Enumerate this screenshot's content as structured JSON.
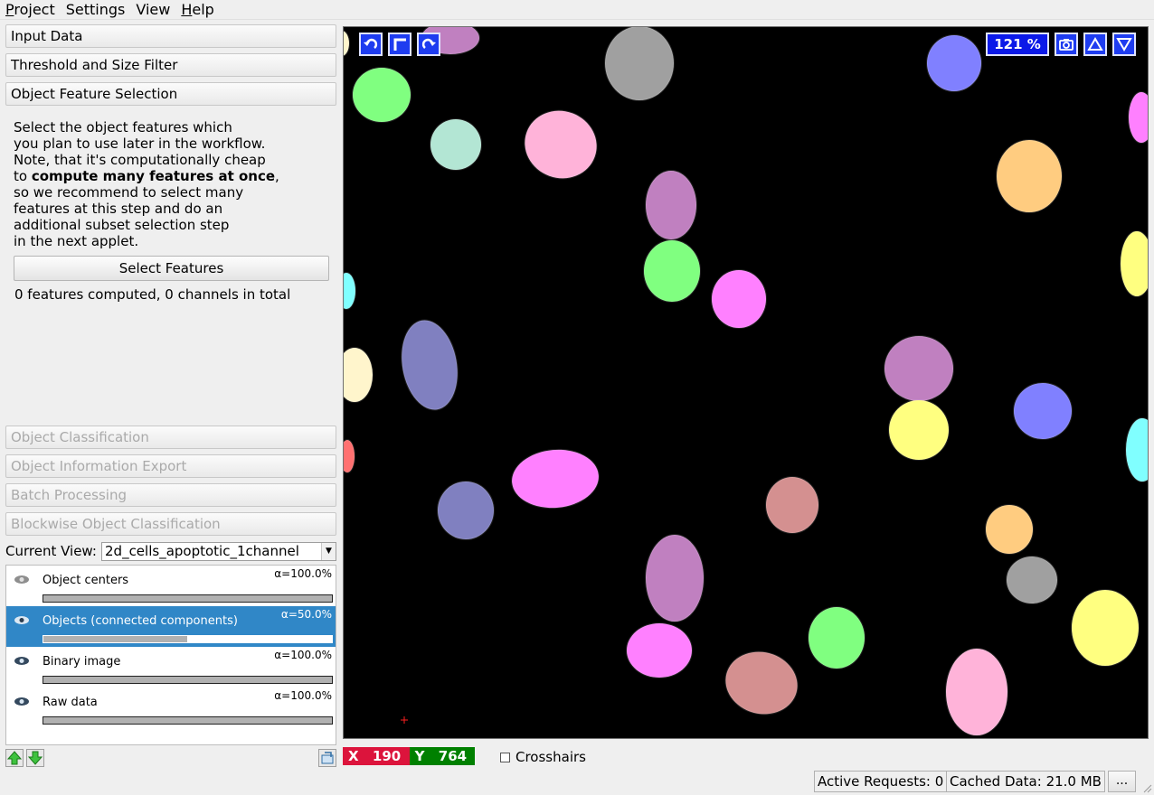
{
  "menubar": {
    "items": [
      {
        "first": "P",
        "rest": "roject"
      },
      {
        "first": "",
        "rest": "Settings"
      },
      {
        "first": "",
        "rest": "View"
      },
      {
        "first": "H",
        "rest": "elp"
      }
    ]
  },
  "applets": {
    "input_data": "Input Data",
    "threshold": "Threshold and Size Filter",
    "feature_selection": "Object Feature Selection",
    "classification": "Object Classification",
    "info_export": "Object Information Export",
    "batch": "Batch Processing",
    "blockwise": "Blockwise Object Classification"
  },
  "feature_panel": {
    "desc_lines": [
      "Select the object features which",
      "you plan to use later in the workflow.",
      "Note, that it's computationally cheap",
      "to ",
      "so we recommend to select many",
      "features at this step and do an",
      "additional subset selection step",
      "in the next applet."
    ],
    "desc_bold": "compute many features at once",
    "desc_bold_suffix": ",",
    "select_button": "Select Features",
    "status": "0 features computed, 0 channels in total"
  },
  "current_view": {
    "label": "Current View:",
    "value": "2d_cells_apoptotic_1channel"
  },
  "layers": [
    {
      "name": "Object centers",
      "alpha": "α=100.0%",
      "opacity": 1.0,
      "selected": false
    },
    {
      "name": "Objects (connected components)",
      "alpha": "α=50.0%",
      "opacity": 0.5,
      "selected": true
    },
    {
      "name": "Binary image",
      "alpha": "α=100.0%",
      "opacity": 1.0,
      "selected": false
    },
    {
      "name": "Raw data",
      "alpha": "α=100.0%",
      "opacity": 1.0,
      "selected": false
    }
  ],
  "viewer": {
    "zoom": "121 %",
    "colors": {
      "pink": "#ffb3d9",
      "green": "#80ff80",
      "violet": "#c080c0",
      "magenta": "#ff80ff",
      "blue": "#8080ff",
      "slate": "#8080c0",
      "orange": "#ffcc80",
      "yellow": "#ffff80",
      "rose": "#d49090",
      "gray": "#a0a0a0",
      "mint": "#b3e6d4",
      "cyan": "#80ffff",
      "cream": "#fff5cc",
      "red": "#ff7070"
    }
  },
  "coordinates": {
    "x_label": "X",
    "x_value": "190",
    "x_color": "#dc143c",
    "y_label": "Y",
    "y_value": "764",
    "y_color": "#008000"
  },
  "crosshairs_label": "Crosshairs",
  "status": {
    "active_requests": "Active Requests: 0",
    "cached_data": "Cached Data: 21.0 MB",
    "more": "..."
  }
}
